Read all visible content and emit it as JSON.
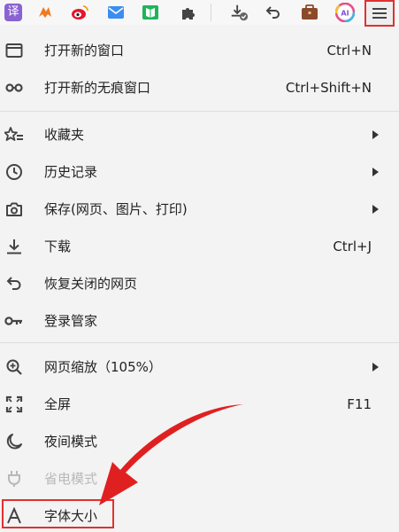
{
  "toolbar": {
    "translate_glyph": "译",
    "menu_highlight_color": "#e03131",
    "icons": [
      "translate-icon",
      "game-icon",
      "weibo-icon",
      "mail-icon",
      "book-icon",
      "puzzle-icon",
      "download-icon",
      "undo-icon",
      "briefcase-icon",
      "ai-icon",
      "hamburger-menu-icon"
    ],
    "ai_badge_text": "AI"
  },
  "menu": {
    "items": [
      {
        "label": "打开新的窗口",
        "shortcut": "Ctrl+N",
        "icon": "window-icon"
      },
      {
        "label": "打开新的无痕窗口",
        "shortcut": "Ctrl+Shift+N",
        "icon": "incognito-icon"
      },
      {
        "label": "收藏夹",
        "shortcut": "",
        "icon": "favorites-star-icon",
        "submenu": true
      },
      {
        "label": "历史记录",
        "shortcut": "",
        "icon": "history-clock-icon",
        "submenu": true
      },
      {
        "label": "保存(网页、图片、打印)",
        "shortcut": "",
        "icon": "camera-icon",
        "submenu": true
      },
      {
        "label": "下载",
        "shortcut": "Ctrl+J",
        "icon": "download-icon"
      },
      {
        "label": "恢复关闭的网页",
        "shortcut": "",
        "icon": "restore-icon"
      },
      {
        "label": "登录管家",
        "shortcut": "",
        "icon": "key-icon"
      },
      {
        "label": "网页缩放（105%）",
        "shortcut": "",
        "icon": "zoom-icon",
        "submenu": true
      },
      {
        "label": "全屏",
        "shortcut": "F11",
        "icon": "fullscreen-icon"
      },
      {
        "label": "夜间模式",
        "shortcut": "",
        "icon": "moon-icon"
      },
      {
        "label": "省电模式",
        "shortcut": "",
        "icon": "plug-icon",
        "disabled": true
      },
      {
        "label": "字体大小",
        "shortcut": "",
        "icon": "font-size-icon",
        "highlighted": true
      }
    ]
  },
  "annotation": {
    "arrow_color": "#e02020",
    "box_color": "#e03131"
  }
}
